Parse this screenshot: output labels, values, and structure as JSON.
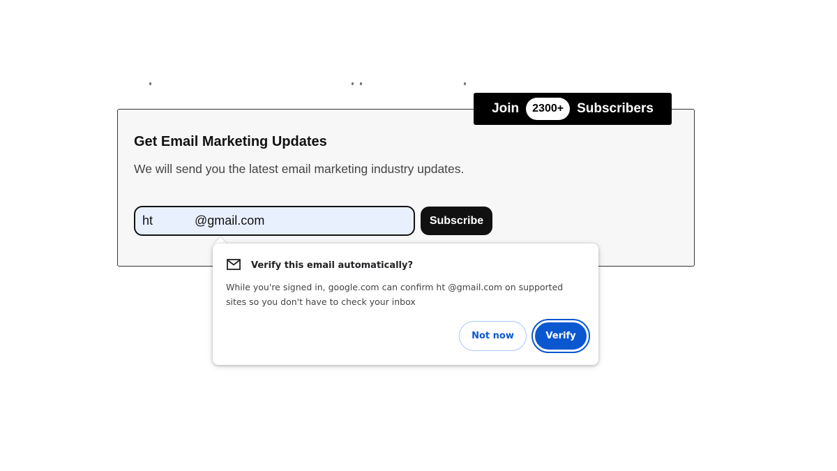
{
  "signup": {
    "title": "Get Email Marketing Updates",
    "subtitle": "We will send you the latest email marketing industry updates.",
    "email_value": "ht            @gmail.com",
    "subscribe_label": "Subscribe",
    "join_prefix": "Join",
    "join_count": "2300+",
    "join_suffix": "Subscribers"
  },
  "verify_popup": {
    "icon": "mail-icon",
    "title": "Verify this email automatically?",
    "body": "While you're signed in, google.com can confirm ht               @gmail.com on supported sites so you don't have to check your inbox",
    "not_now_label": "Not now",
    "verify_label": "Verify"
  },
  "colors": {
    "accent_blue": "#0b57d0",
    "input_bg": "#e8f0fe",
    "dark": "#111111"
  }
}
